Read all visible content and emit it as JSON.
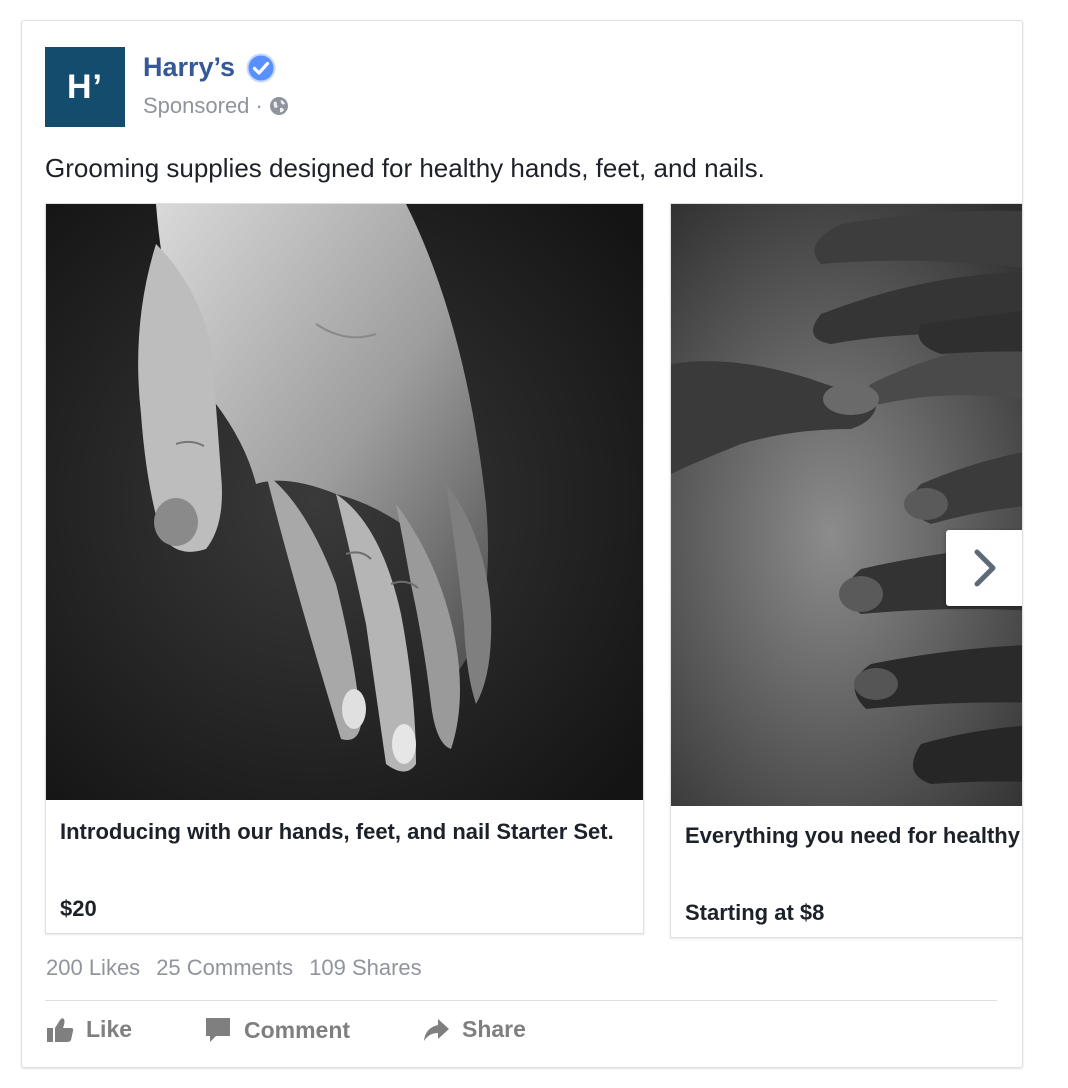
{
  "page": {
    "avatar_text": "H’",
    "name": "Harry’s",
    "sponsored_label": "Sponsored ·"
  },
  "post": {
    "text": "Grooming supplies designed for healthy hands, feet, and nails."
  },
  "carousel": {
    "cards": [
      {
        "title": "Introducing with our hands, feet, and nail Starter Set.",
        "price": "$20"
      },
      {
        "title": "Everything you need for healthy nail beds.",
        "price": "Starting at $8"
      }
    ]
  },
  "stats": {
    "likes": "200 Likes",
    "comments": "25 Comments",
    "shares": "109 Shares"
  },
  "actions": {
    "like": "Like",
    "comment": "Comment",
    "share": "Share"
  },
  "colors": {
    "brand": "#134c6c",
    "link": "#365899",
    "verified": "#5890ff",
    "muted": "#90949c"
  },
  "icons": {
    "verified": "verified-badge-icon",
    "globe": "globe-icon",
    "next": "chevron-right-icon",
    "like": "thumbs-up-icon",
    "comment": "comment-bubble-icon",
    "share": "share-arrow-icon"
  }
}
